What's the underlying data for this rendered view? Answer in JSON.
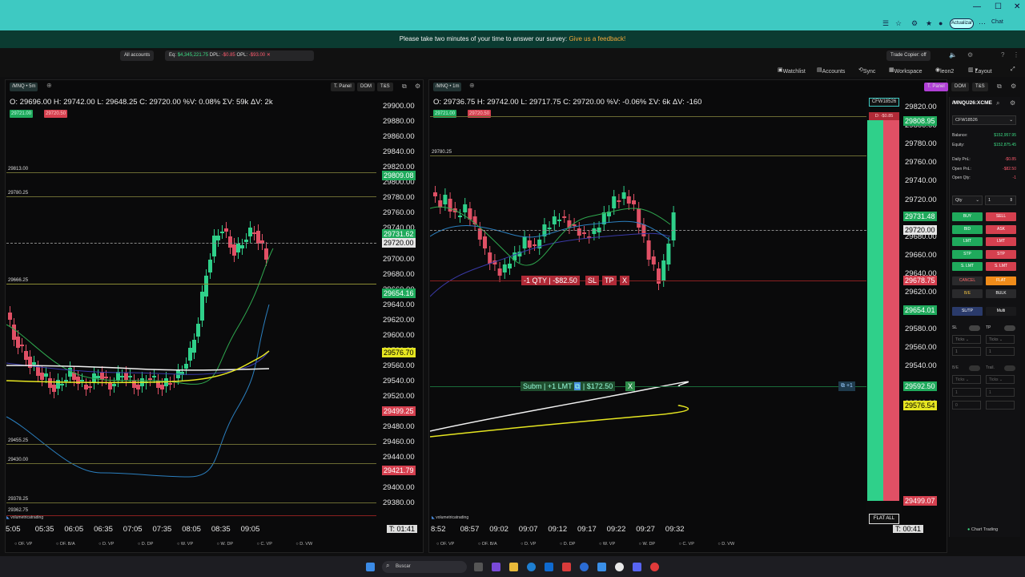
{
  "survey": {
    "text": "Please take two minutes of your time to answer our survey:",
    "link": "Give us a feedback!"
  },
  "browser": {
    "actualizar": "Actualizar",
    "chat": "Chat"
  },
  "account_bar": {
    "all_accounts": "All accounts",
    "eq_label": "Eq:",
    "eq_value": "$4,345,221.75",
    "dpl_label": "DPL:",
    "dpl_value": "-$0.85",
    "opl_label": "OPL:",
    "opl_value": "-$93.00",
    "trade_copier": "Trade Copier: off"
  },
  "toolbar": {
    "watchlist": "Watchlist",
    "accounts": "Accounts",
    "sync": "Sync",
    "workspace": "Workspace",
    "user": "leon2",
    "layout": "Layout"
  },
  "left_chart": {
    "symbol": "/MNQ",
    "timeframe": "5m",
    "header_buttons": [
      "T. Panel",
      "DOM",
      "T&S"
    ],
    "ohlc": "O: 29696.00  H: 29742.00  L: 29648.25  C: 29720.00  %V: 0.08%  ΣV: 59k  ΔV: 2k",
    "bid_tag": "29721.00",
    "ask_tag": "29720.50",
    "y_ticks": [
      "29900.00",
      "29880.00",
      "29860.00",
      "29840.00",
      "29820.00",
      "29800.00",
      "29780.00",
      "29760.00",
      "29740.00",
      "29720.00",
      "29700.00",
      "29680.00",
      "29660.00",
      "29640.00",
      "29620.00",
      "29600.00",
      "29580.00",
      "29560.00",
      "29540.00",
      "29520.00",
      "29500.00",
      "29480.00",
      "29460.00",
      "29440.00",
      "29420.00",
      "29400.00",
      "29380.00"
    ],
    "price_labels": {
      "p1": "29809.08",
      "p2": "29731.62",
      "p3": "29720.00",
      "p4": "29654.16",
      "p5": "29576.70",
      "p6": "29499.25",
      "p7": "29421.79"
    },
    "levels": [
      "29813.00",
      "29780.25",
      "29666.25",
      "29455.25",
      "29430.00",
      "29378.25",
      "29362.75"
    ],
    "x_ticks": [
      "5:05",
      "05:35",
      "06:05",
      "06:35",
      "07:05",
      "07:35",
      "08:05",
      "08:35",
      "09:05"
    ],
    "timer": "T: 01:41",
    "brand": "volumetricatrading",
    "bottom_tabs": [
      "OF. VP",
      "OF. B/A",
      "D. VP",
      "D. DP",
      "W. VP",
      "W. DP",
      "C. VP",
      "D. VW"
    ]
  },
  "right_chart": {
    "symbol": "/MNQ",
    "timeframe": "1m",
    "header_buttons": [
      "T. Panel",
      "DOM",
      "T&S"
    ],
    "ohlc": "O: 29736.75  H: 29742.00  L: 29717.75  C: 29720.00  %V: -0.06%  ΣV: 6k  ΔV: -160",
    "bid_tag": "29721.00",
    "ask_tag": "29720.50",
    "y_ticks": [
      "29820.00",
      "29800.00",
      "29780.00",
      "29760.00",
      "29740.00",
      "29720.00",
      "29700.00",
      "29680.00",
      "29660.00",
      "29640.00",
      "29620.00",
      "29600.00",
      "29580.00",
      "29560.00",
      "29540.00",
      "29520.00",
      "29500.00"
    ],
    "price_labels": {
      "p1": "29808.95",
      "p2": "29731.48",
      "p3": "29720.00",
      "p4": "29678.75",
      "p5": "29654.01",
      "p6": "29592.50",
      "p7": "29576.54",
      "p8": "29499.07"
    },
    "level": "29780.25",
    "position": {
      "qty": "-1 QTY",
      "pnl": "-$82.50",
      "sl": "SL",
      "tp": "TP",
      "x": "X"
    },
    "order": {
      "subm": "Subm",
      "desc": "+1 LMT",
      "value": "$172.50",
      "x": "X",
      "right": "+1"
    },
    "account_tag": "CFW18526",
    "dpl_tag": "D: -$0.85",
    "flat_all": "FLAT ALL",
    "x_ticks": [
      "8:52",
      "08:57",
      "09:02",
      "09:07",
      "09:12",
      "09:17",
      "09:22",
      "09:27",
      "09:32"
    ],
    "timer": "T: 00:41",
    "brand": "volumetricatrading",
    "bottom_tabs": [
      "OF. VP",
      "OF. B/A",
      "D. VP",
      "D. DP",
      "W. VP",
      "W. DP",
      "C. VP",
      "D. VW"
    ]
  },
  "side_panel": {
    "symbol": "/MNQU26:XCME",
    "account": "CFW18526",
    "balance_label": "Balance:",
    "balance": "$152,957.95",
    "equity_label": "Equity:",
    "equity": "$152,875.45",
    "daily_pnl_label": "Daily PnL:",
    "daily_pnl": "-$0.85",
    "open_pnl_label": "Open PnL:",
    "open_pnl": "-$82.50",
    "open_qty_label": "Open Qty:",
    "open_qty": "-1",
    "qty_label": "Qty",
    "qty_value": "1",
    "buttons": {
      "buy": "BUY",
      "sell": "SELL",
      "bid": "BID",
      "ask": "ASK",
      "lmt_b": "LMT",
      "lmt_s": "LMT",
      "stp_b": "STP",
      "stp_s": "STP",
      "slmt_b": "S. LMT",
      "slmt_s": "S. LMT",
      "cancel": "CANCEL",
      "flat": "FLAT",
      "be": "B/E",
      "bulk": "BULK"
    },
    "tab_sltp": "SL/TP",
    "tab_multi": "Multi",
    "sl_label": "SL",
    "tp_label": "TP",
    "ticks": "Ticks",
    "be_label": "B/E",
    "trail_label": "Trail.",
    "footer": "Chart Trading"
  },
  "taskbar": {
    "search": "Buscar"
  }
}
